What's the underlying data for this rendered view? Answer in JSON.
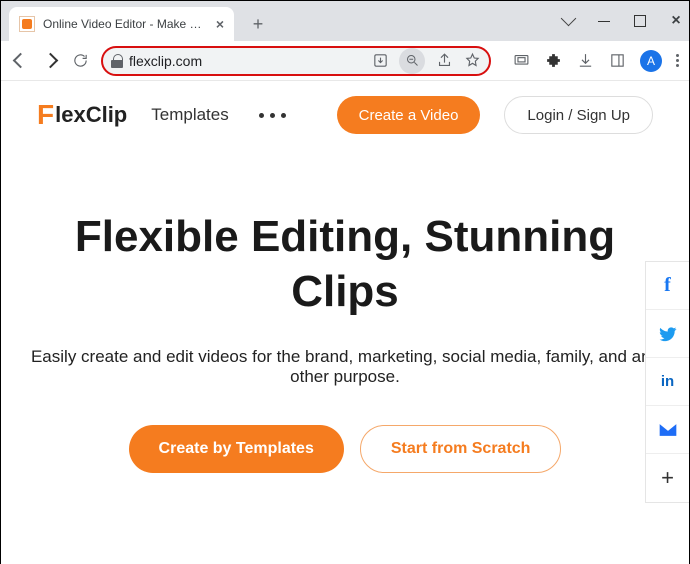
{
  "browser": {
    "tab_title": "Online Video Editor - Make Vide",
    "url": "flexclip.com",
    "avatar_initial": "A"
  },
  "site": {
    "logo_f": "F",
    "logo_rest": "lexClip",
    "nav": {
      "templates": "Templates"
    },
    "header_buttons": {
      "create": "Create a Video",
      "login": "Login / Sign Up"
    }
  },
  "hero": {
    "headline": "Flexible Editing, Stunning Clips",
    "subtext": "Easily create and edit videos for the brand, marketing, social media, family, and any other purpose.",
    "cta_primary": "Create by Templates",
    "cta_secondary": "Start from Scratch"
  },
  "social": {
    "fb": "f",
    "linkedin": "in",
    "plus": "+"
  }
}
